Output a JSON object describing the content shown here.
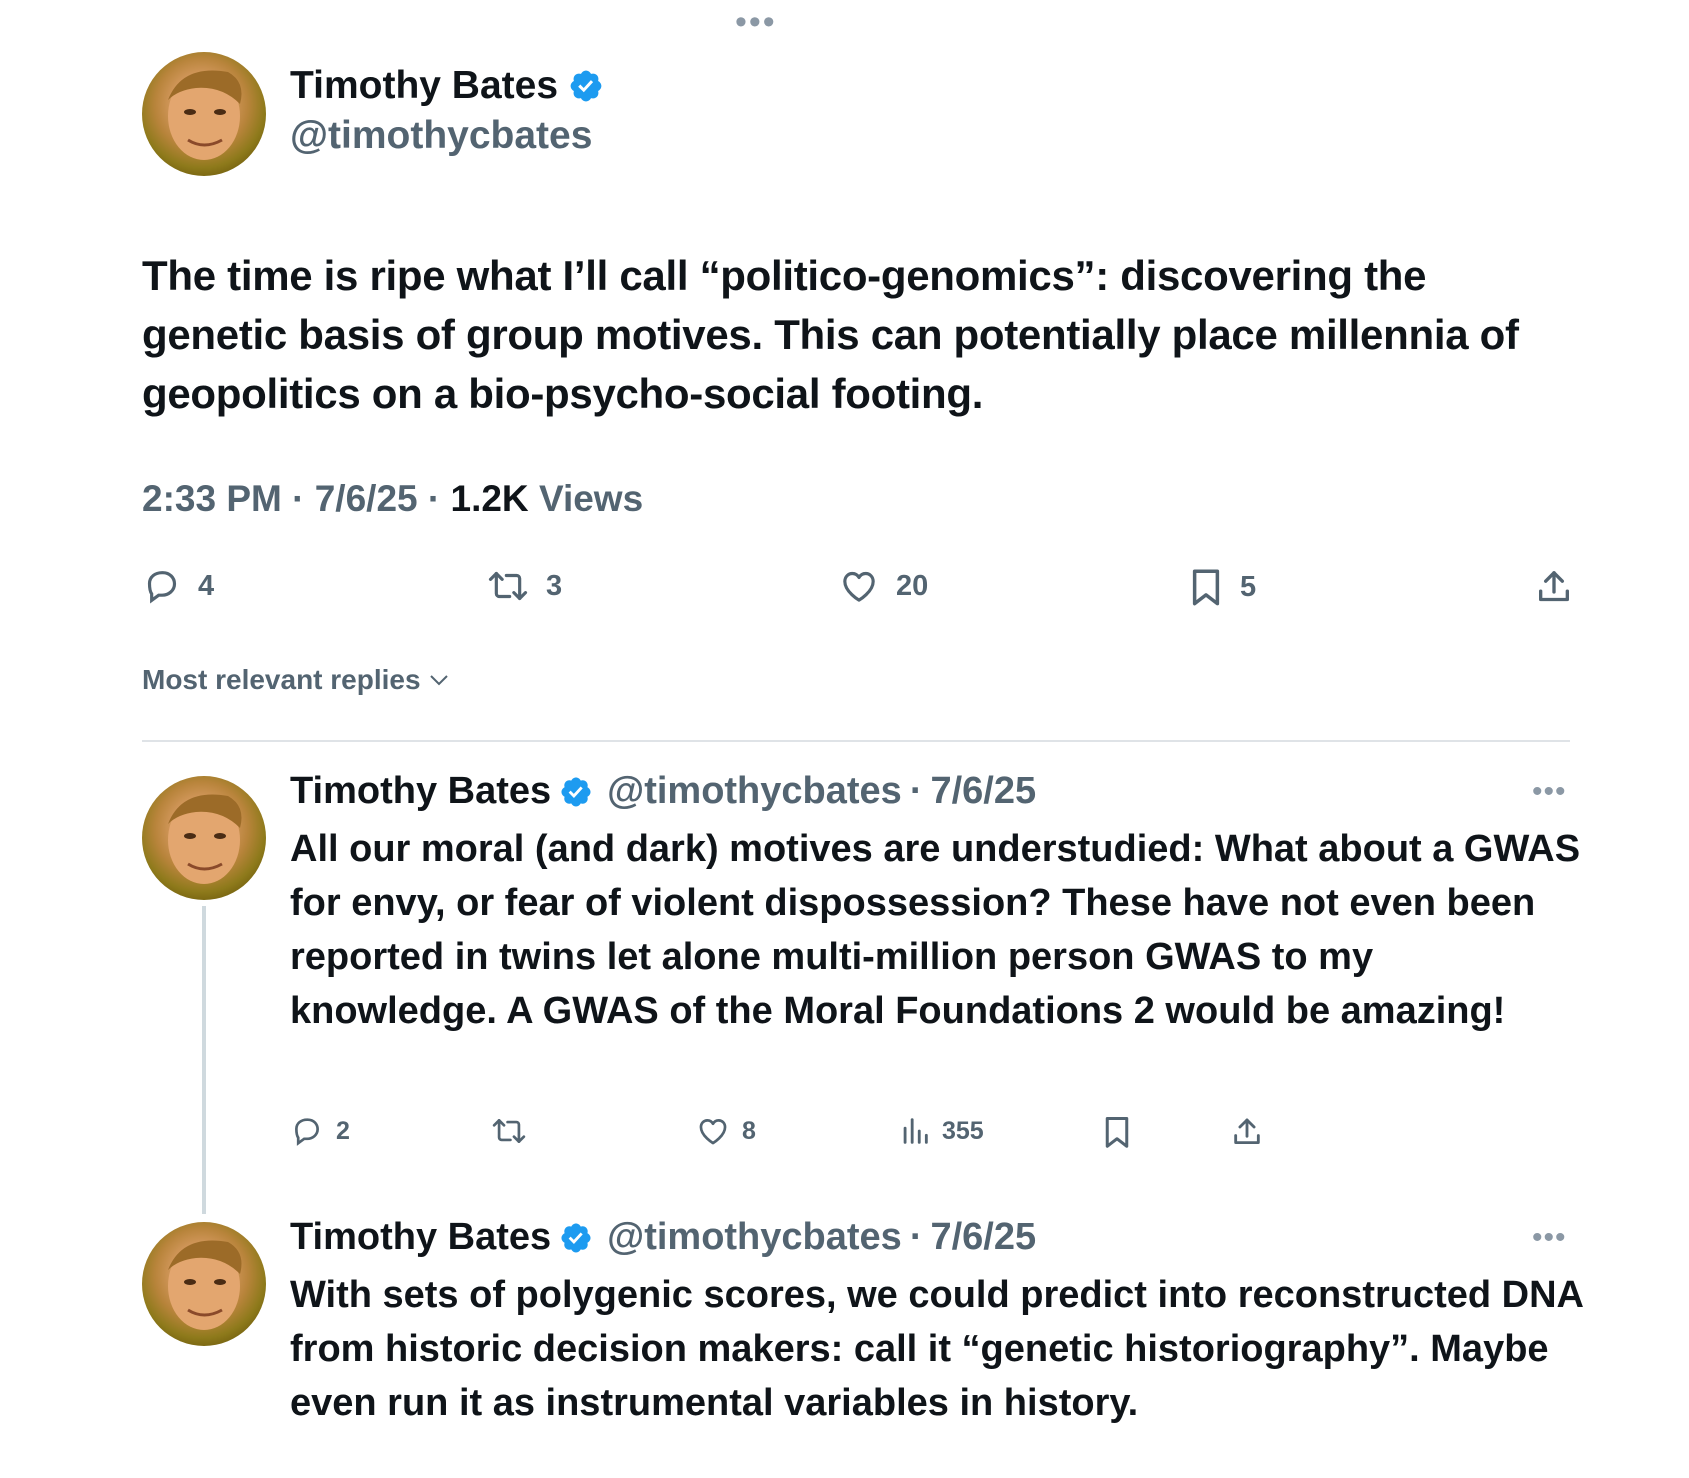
{
  "main_tweet": {
    "name": "Timothy Bates",
    "handle": "@timothycbates",
    "text": "The time is ripe what I’ll call “politico-genomics”: discovering the genetic basis of group motives. This can potentially place millennia of geopolitics on a bio-psycho-social footing.",
    "time": "2:33 PM",
    "date": "7/6/25",
    "views_count": "1.2K",
    "views_label": "Views",
    "separator": "·",
    "actions": {
      "replies": "4",
      "reposts": "3",
      "likes": "20",
      "bookmarks": "5"
    }
  },
  "sort": {
    "label": "Most relevant replies"
  },
  "replies": [
    {
      "name": "Timothy Bates",
      "handle": "@timothycbates",
      "date": "7/6/25",
      "separator": "·",
      "text": "All our moral (and dark) motives are understudied: What about a GWAS for envy, or fear of violent dispossession? These have not even been reported in twins let alone multi-million person GWAS to my knowledge. A GWAS of the Moral Foundations 2 would be amazing!",
      "actions": {
        "replies": "2",
        "reposts": "",
        "likes": "8",
        "views": "355"
      }
    },
    {
      "name": "Timothy Bates",
      "handle": "@timothycbates",
      "date": "7/6/25",
      "separator": "·",
      "text": "With sets of polygenic scores, we could predict into reconstructed DNA from historic decision makers: call it “genetic historiography”. Maybe even run it as instrumental variables in history."
    }
  ],
  "colors": {
    "text_primary": "#0f1419",
    "text_secondary": "#536471",
    "verified_blue": "#1d9bf0",
    "divider": "#dfe3e7",
    "thread_line": "#cfd9de"
  },
  "icons": {
    "verified": "verified-badge-icon",
    "reply": "reply-bubble-icon",
    "repost": "repost-icon",
    "like": "heart-icon",
    "bookmark": "bookmark-icon",
    "share": "share-upload-icon",
    "views": "bar-chart-icon",
    "more": "more-dots-icon",
    "sort": "chevron-down-icon"
  }
}
